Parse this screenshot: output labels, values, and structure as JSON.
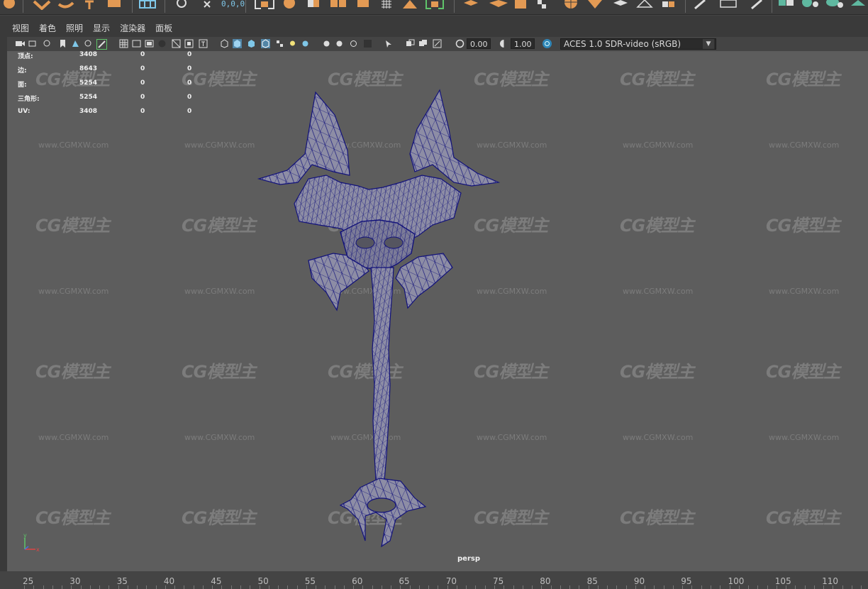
{
  "shelf": {
    "coord_readout": "0,0,0",
    "icons": [
      "transform-icon",
      "curve-icon",
      "text-tool-icon",
      "box-icon",
      "grid-icon",
      "snap-icon",
      "snap-point-icon",
      "bracket-icon",
      "sphere-icon",
      "cube-stack-icon",
      "cube-icon",
      "grid-small-icon",
      "cube-split-icon",
      "bracket-right-icon",
      "cube-open-icon",
      "cube-unfold-icon",
      "box-open-icon",
      "checker-icon",
      "target-icon",
      "diamond-icon",
      "pyramid-icon",
      "cube-grid-icon",
      "pen-icon",
      "pencil-icon",
      "ring-icon",
      "box-green-icon",
      "sphere-green-icon",
      "cylinder-green-icon",
      "cone-green-icon"
    ]
  },
  "menubar": {
    "items": [
      "视图",
      "着色",
      "照明",
      "显示",
      "渲染器",
      "面板"
    ]
  },
  "toolbar": {
    "exposure": "0.00",
    "gamma": "1.00",
    "color_space": "ACES 1.0 SDR-video (sRGB)"
  },
  "hud": {
    "rows": [
      {
        "label": "顶点:",
        "v1": "3408",
        "v2": "0",
        "v3": "0"
      },
      {
        "label": "边:",
        "v1": "8643",
        "v2": "0",
        "v3": "0"
      },
      {
        "label": "面:",
        "v1": "5254",
        "v2": "0",
        "v3": "0"
      },
      {
        "label": "三角形:",
        "v1": "5254",
        "v2": "0",
        "v3": "0"
      },
      {
        "label": "UV:",
        "v1": "3408",
        "v2": "0",
        "v3": "0"
      }
    ]
  },
  "watermark": {
    "logo": "CG模型主",
    "url": "www.CGMXW.com"
  },
  "viewport": {
    "camera_label": "persp"
  },
  "axis": {
    "x": "x",
    "y": "y"
  },
  "time_ruler": {
    "labels": [
      "25",
      "30",
      "35",
      "40",
      "45",
      "50",
      "55",
      "60",
      "65",
      "70",
      "75",
      "80",
      "85",
      "90",
      "95",
      "100",
      "105",
      "110"
    ]
  },
  "colors": {
    "wire": "#12127a",
    "mesh_fill": "#8d8da5",
    "viewport_bg": "#5d5d5d",
    "shelf_orange": "#e39a54",
    "shelf_teal": "#5fb8a0"
  }
}
